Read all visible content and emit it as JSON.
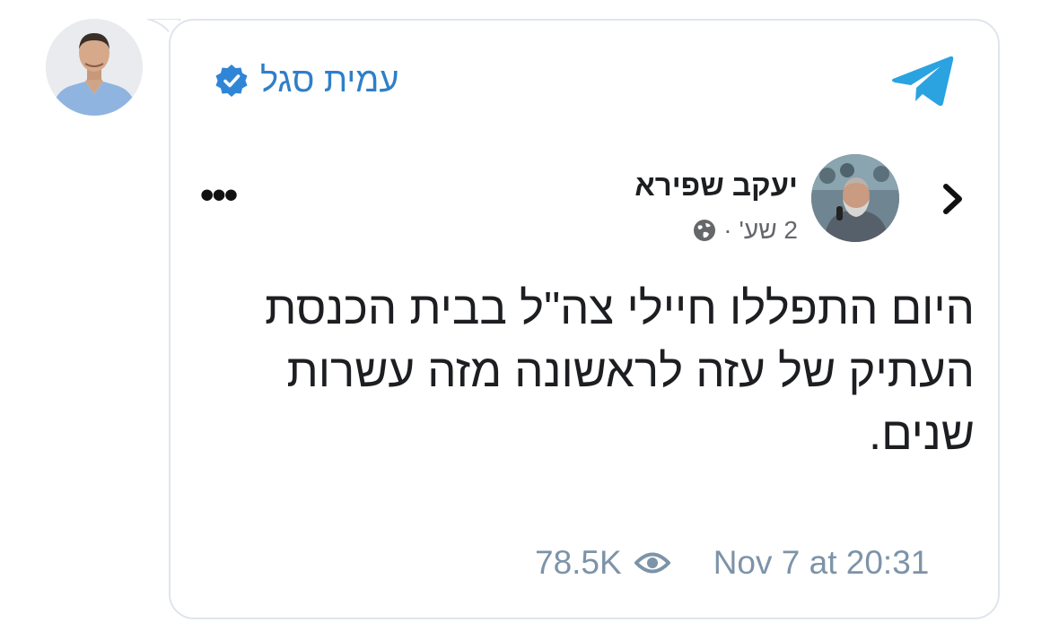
{
  "message": {
    "sender_name": "עמית סגל",
    "verified": true,
    "views": "78.5K",
    "timestamp": "Nov 7 at 20:31"
  },
  "embedded_post": {
    "author": "יעקב שפירא",
    "age": "2 שע'",
    "separator": "·",
    "menu_label": "•••",
    "text_lines": [
      "היום התפללו חיילי צה\"ל בבית הכנסת",
      "העתיק של עזה לראשונה מזה עשרות",
      "שנים."
    ]
  },
  "colors": {
    "accent_blue": "#2f7fc8",
    "telegram_blue": "#2aa3e0",
    "muted": "#7d93a8",
    "border": "#dfe5ec"
  },
  "icons": {
    "app": "telegram-icon",
    "verified": "verified-badge-icon",
    "privacy": "globe-icon",
    "views": "eye-icon",
    "nav": "chevron-right-icon"
  }
}
